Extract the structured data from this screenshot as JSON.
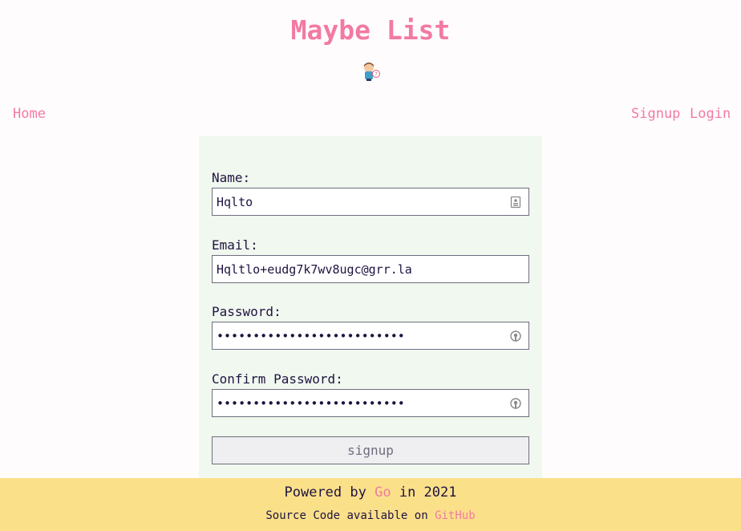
{
  "header": {
    "title": "Maybe List"
  },
  "nav": {
    "home": "Home",
    "signup": "Signup",
    "login": "Login"
  },
  "form": {
    "name_label": "Name:",
    "name_value": "Hqlto",
    "email_label": "Email:",
    "email_value": "Hqltlo+eudg7k7wv8ugc@grr.la",
    "password_label": "Password:",
    "password_value": "••••••••••••••••••••••••••",
    "confirm_label": "Confirm Password:",
    "confirm_value": "••••••••••••••••••••••••••",
    "submit_label": "signup"
  },
  "footer": {
    "powered_prefix": "Powered by",
    "powered_link": "Go",
    "powered_suffix": "in 2021",
    "source_prefix": "Source Code available on",
    "source_link": "GitHub"
  },
  "colors": {
    "accent": "#f27aa3",
    "panel": "#f0f8ef",
    "footer": "#fbe08a",
    "text": "#1f1340"
  },
  "icons": {
    "field_contact": "contact-card-icon",
    "field_password": "password-manager-icon",
    "mascot": "gopher-mascot-icon"
  }
}
